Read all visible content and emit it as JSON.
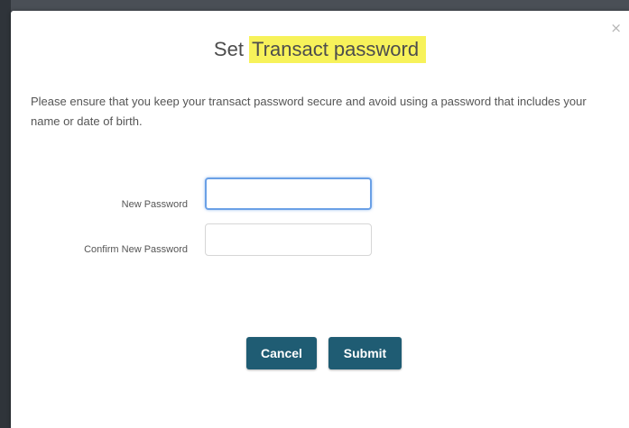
{
  "dialog": {
    "close_symbol": "×",
    "title_prefix": "Set ",
    "title_highlight": "Transact password",
    "description": "Please ensure that you keep your transact password secure and avoid using a password that includes your name or date of birth.",
    "fields": {
      "new_password_label": "New Password",
      "new_password_value": "",
      "confirm_password_label": "Confirm New Password",
      "confirm_password_value": ""
    },
    "buttons": {
      "cancel_label": "Cancel",
      "submit_label": "Submit"
    }
  },
  "colors": {
    "primary_button": "#1f5c73",
    "title_highlight": "#f7f25a",
    "focus_border": "#6aa0e6"
  },
  "icons": {
    "close": "close-icon"
  }
}
